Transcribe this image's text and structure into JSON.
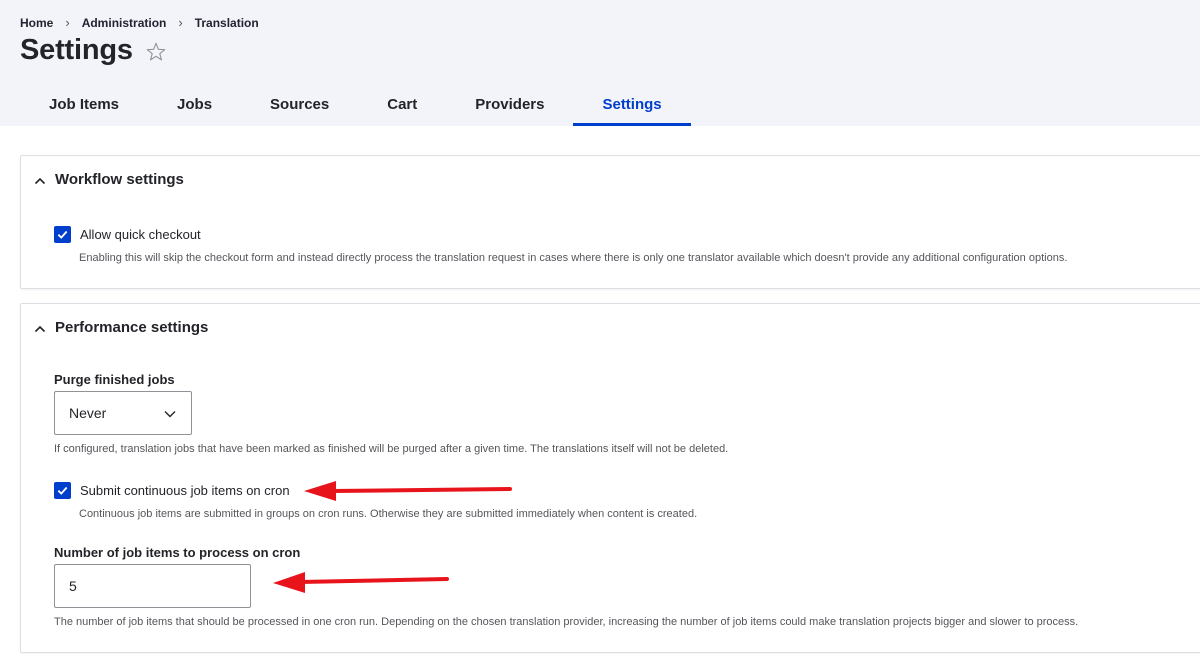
{
  "breadcrumb": {
    "items": [
      "Home",
      "Administration",
      "Translation"
    ],
    "separator": "›"
  },
  "page": {
    "title": "Settings",
    "favorite_icon": "star-outline-icon"
  },
  "tabs": [
    {
      "label": "Job Items",
      "active": false
    },
    {
      "label": "Jobs",
      "active": false
    },
    {
      "label": "Sources",
      "active": false
    },
    {
      "label": "Cart",
      "active": false
    },
    {
      "label": "Providers",
      "active": false
    },
    {
      "label": "Settings",
      "active": true
    }
  ],
  "workflow": {
    "summary": "Workflow settings",
    "quick_checkout": {
      "label": "Allow quick checkout",
      "checked": true,
      "description": "Enabling this will skip the checkout form and instead directly process the translation request in cases where there is only one translator available which doesn't provide any additional configuration options."
    }
  },
  "performance": {
    "summary": "Performance settings",
    "purge": {
      "label": "Purge finished jobs",
      "selected": "Never",
      "description": "If configured, translation jobs that have been marked as finished will be purged after a given time. The translations itself will not be deleted."
    },
    "continuous": {
      "label": "Submit continuous job items on cron",
      "checked": true,
      "description": "Continuous job items are submitted in groups on cron runs. Otherwise they are submitted immediately when content is created."
    },
    "cron_items": {
      "label": "Number of job items to process on cron",
      "value": "5",
      "description": "The number of job items that should be processed in one cron run. Depending on the chosen translation provider, increasing the number of job items could make translation projects bigger and slower to process."
    }
  },
  "colors": {
    "accent": "#003ecc",
    "header_bg": "#f3f4f9",
    "annotation": "#e8141b"
  }
}
